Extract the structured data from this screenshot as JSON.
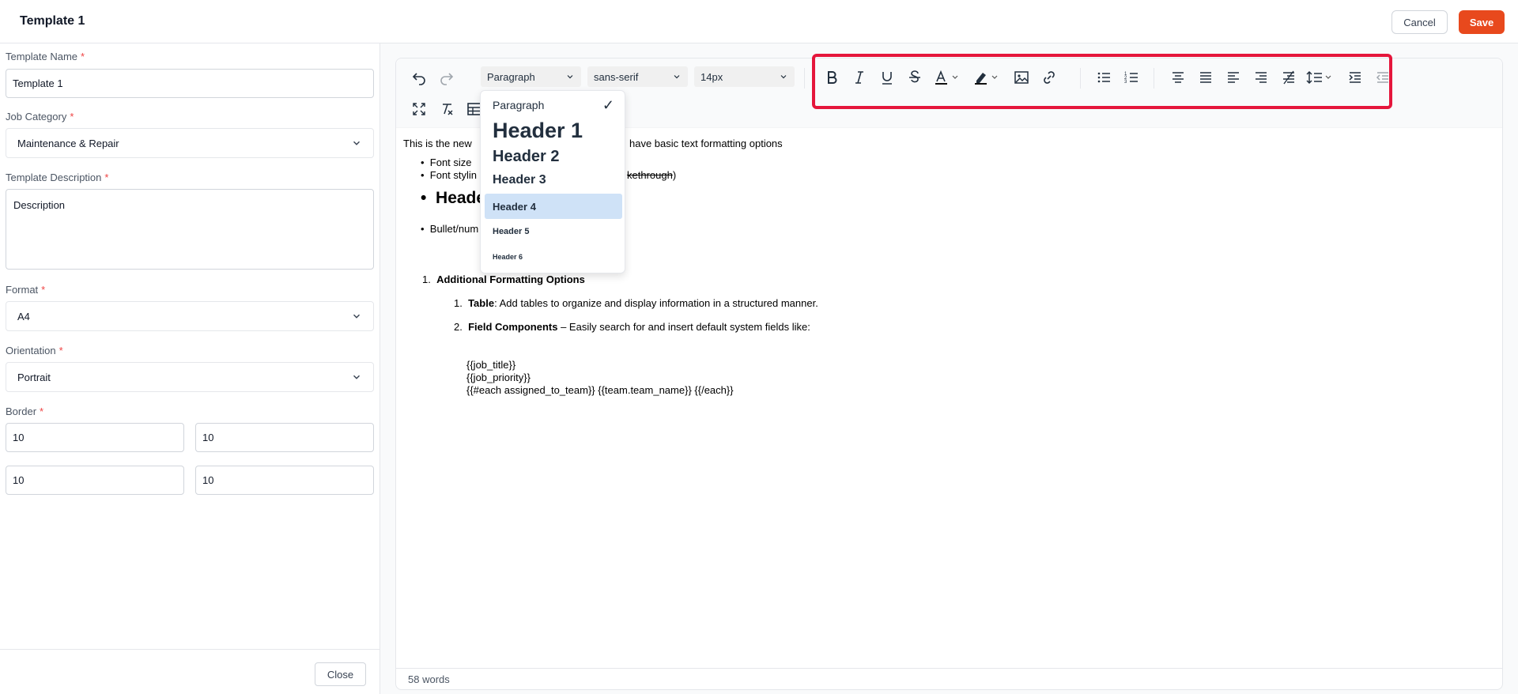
{
  "header": {
    "title": "Template 1",
    "cancel_label": "Cancel",
    "save_label": "Save",
    "save_color": "#e8491d"
  },
  "form": {
    "template_name": {
      "label": "Template Name",
      "required": "*",
      "value": "Template 1"
    },
    "job_category": {
      "label": "Job Category",
      "required": "*",
      "value": "Maintenance & Repair"
    },
    "template_description": {
      "label": "Template Description",
      "required": "*",
      "value": "Description"
    },
    "format": {
      "label": "Format",
      "required": "*",
      "value": "A4"
    },
    "orientation": {
      "label": "Orientation",
      "required": "*",
      "value": "Portrait"
    },
    "border": {
      "label": "Border",
      "required": "*",
      "values": [
        "10",
        "10",
        "10",
        "10"
      ]
    },
    "close_label": "Close"
  },
  "toolbar": {
    "block_format": "Paragraph",
    "font_family": "sans-serif",
    "font_size": "14px",
    "highlight_color": "#e5163b",
    "icons": [
      "undo-icon",
      "redo-icon",
      "bold-icon",
      "italic-icon",
      "underline-icon",
      "strikethrough-icon",
      "text-color-icon",
      "highlight-color-icon",
      "image-icon",
      "link-icon",
      "bullet-list-icon",
      "numbered-list-icon",
      "align-center-icon",
      "align-justify-icon",
      "align-left-icon",
      "align-right-icon",
      "clear-direction-icon",
      "line-height-icon",
      "indent-icon",
      "outdent-icon",
      "fullscreen-icon",
      "clear-formatting-icon",
      "table-icon"
    ]
  },
  "block_dropdown": {
    "items": [
      "Paragraph",
      "Header 1",
      "Header 2",
      "Header 3",
      "Header 4",
      "Header 5",
      "Header 6"
    ],
    "selected": "Paragraph",
    "hovered": "Header 4"
  },
  "document": {
    "intro": "This is the new",
    "intro_tail": "have basic text formatting options",
    "bullet1": "Font size",
    "bullet2": "Font stylin",
    "bullet2_tail": "kethrough",
    "bullet2_paren": ")",
    "heading": "Heade",
    "bullet3": "Bullet/num",
    "ol_title": "Additional Formatting Options",
    "ol_n1": "1.",
    "sub1_num": "1.",
    "sub1_bold": "Table",
    "sub1_text": ": Add tables to organize and display information in a structured manner.",
    "sub2_num": "2.",
    "sub2_bold": "Field Components",
    "sub2_text": " – Easily search for and insert default system fields like:",
    "field1": "{{job_title}}",
    "field2": "{{job_priority}}",
    "field3": "{{#each assigned_to_team}} {{team.team_name}} {{/each}}"
  },
  "status": {
    "word_count": "58 words"
  }
}
